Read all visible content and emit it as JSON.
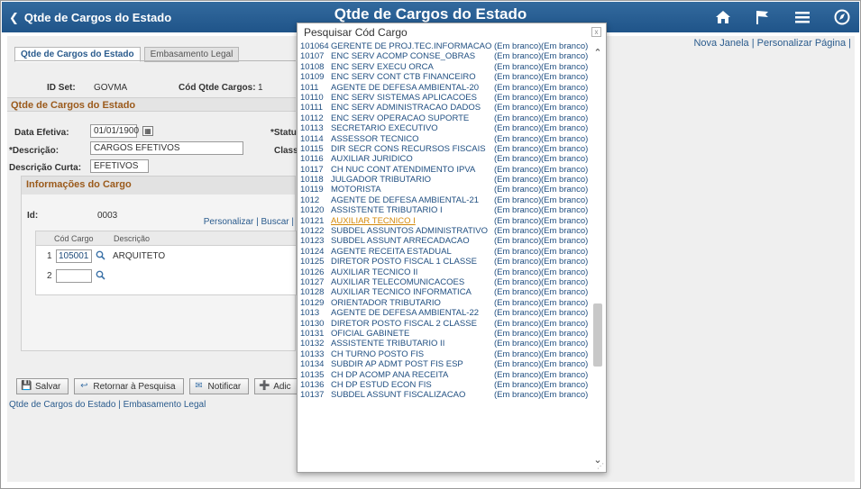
{
  "banner": {
    "back_label": "Qtde de Cargos do Estado",
    "title": "Qtde de Cargos do Estado",
    "icons": [
      "home-icon",
      "flag-icon",
      "menu-icon",
      "navbar-icon"
    ]
  },
  "right_links": {
    "new_window": "Nova Janela",
    "sep": "|",
    "personalize": "Personalizar Página",
    "sep2": "|"
  },
  "tabs": {
    "tab1": "Qtde de Cargos do Estado",
    "tab2": "Embasamento Legal"
  },
  "header": {
    "set_id_label": "ID Set:",
    "set_id_value": "GOVMA",
    "cod_label": "Cód Qtde Cargos:",
    "cod_value": "1"
  },
  "section": {
    "title": "Qtde de Cargos do Estado"
  },
  "form": {
    "data_label": "Data Efetiva:",
    "data_value": "01/01/1900",
    "status_label": "*Statu",
    "descr_label": "*Descrição:",
    "descr_value": "CARGOS EFETIVOS",
    "class_label": "Class",
    "descr_curta_label": "Descrição Curta:",
    "descr_curta_value": "EFETIVOS"
  },
  "cargo": {
    "title": "Informações do Cargo",
    "id_label": "Id:",
    "id_value": "0003",
    "links": "Personalizar | Buscar |",
    "col1": "Cód Cargo",
    "col2": "Descrição",
    "rows": [
      {
        "num": "1",
        "code": "105001",
        "desc": "ARQUITETO"
      },
      {
        "num": "2",
        "code": "",
        "desc": ""
      }
    ]
  },
  "toolbar": {
    "save": "Salvar",
    "return": "Retornar à Pesquisa",
    "notify": "Notificar",
    "add": "Adic"
  },
  "footer_links": "Qtde de Cargos do Estado | Embasamento Legal",
  "modal": {
    "title": "Pesquisar Cód Cargo",
    "close": "x",
    "rows": [
      {
        "code": "101064",
        "name": "GERENTE DE PROJ.TEC.INFORMACAO",
        "b1": "(Em branco)",
        "b2": "(Em branco)"
      },
      {
        "code": "10107",
        "name": "ENC SERV ACOMP CONSE_OBRAS",
        "b1": "(Em branco)",
        "b2": "(Em branco)"
      },
      {
        "code": "10108",
        "name": "ENC SERV EXECU ORCA",
        "b1": "(Em branco)",
        "b2": "(Em branco)"
      },
      {
        "code": "10109",
        "name": "ENC SERV CONT CTB FINANCEIRO",
        "b1": "(Em branco)",
        "b2": "(Em branco)"
      },
      {
        "code": "1011",
        "name": "AGENTE DE DEFESA AMBIENTAL-20",
        "b1": "(Em branco)",
        "b2": "(Em branco)"
      },
      {
        "code": "10110",
        "name": "ENC SERV SISTEMAS APLICACOES",
        "b1": "(Em branco)",
        "b2": "(Em branco)"
      },
      {
        "code": "10111",
        "name": "ENC SERV ADMINISTRACAO DADOS",
        "b1": "(Em branco)",
        "b2": "(Em branco)"
      },
      {
        "code": "10112",
        "name": "ENC SERV OPERACAO SUPORTE",
        "b1": "(Em branco)",
        "b2": "(Em branco)"
      },
      {
        "code": "10113",
        "name": "SECRETARIO EXECUTIVO",
        "b1": "(Em branco)",
        "b2": "(Em branco)"
      },
      {
        "code": "10114",
        "name": "ASSESSOR TECNICO",
        "b1": "(Em branco)",
        "b2": "(Em branco)"
      },
      {
        "code": "10115",
        "name": "DIR SECR CONS RECURSOS FISCAIS",
        "b1": "(Em branco)",
        "b2": "(Em branco)"
      },
      {
        "code": "10116",
        "name": "AUXILIAR JURIDICO",
        "b1": "(Em branco)",
        "b2": "(Em branco)"
      },
      {
        "code": "10117",
        "name": "CH NUC CONT ATENDIMENTO IPVA",
        "b1": "(Em branco)",
        "b2": "(Em branco)"
      },
      {
        "code": "10118",
        "name": "JULGADOR TRIBUTARIO",
        "b1": "(Em branco)",
        "b2": "(Em branco)"
      },
      {
        "code": "10119",
        "name": "MOTORISTA",
        "b1": "(Em branco)",
        "b2": "(Em branco)"
      },
      {
        "code": "1012",
        "name": "AGENTE DE DEFESA AMBIENTAL-21",
        "b1": "(Em branco)",
        "b2": "(Em branco)"
      },
      {
        "code": "10120",
        "name": "ASSISTENTE TRIBUTARIO I",
        "b1": "(Em branco)",
        "b2": "(Em branco)"
      },
      {
        "code": "10121",
        "name": "AUXILIAR TECNICO I",
        "b1": "(Em branco)",
        "b2": "(Em branco)"
      },
      {
        "code": "10122",
        "name": "SUBDEL ASSUNTOS ADMINISTRATIVO",
        "b1": "(Em branco)",
        "b2": "(Em branco)"
      },
      {
        "code": "10123",
        "name": "SUBDEL ASSUNT ARRECADACAO",
        "b1": "(Em branco)",
        "b2": "(Em branco)"
      },
      {
        "code": "10124",
        "name": "AGENTE RECEITA ESTADUAL",
        "b1": "(Em branco)",
        "b2": "(Em branco)"
      },
      {
        "code": "10125",
        "name": "DIRETOR POSTO FISCAL 1 CLASSE",
        "b1": "(Em branco)",
        "b2": "(Em branco)"
      },
      {
        "code": "10126",
        "name": "AUXILIAR TECNICO II",
        "b1": "(Em branco)",
        "b2": "(Em branco)"
      },
      {
        "code": "10127",
        "name": "AUXILIAR TELECOMUNICACOES",
        "b1": "(Em branco)",
        "b2": "(Em branco)"
      },
      {
        "code": "10128",
        "name": "AUXILIAR TECNICO INFORMATICA",
        "b1": "(Em branco)",
        "b2": "(Em branco)"
      },
      {
        "code": "10129",
        "name": "ORIENTADOR TRIBUTARIO",
        "b1": "(Em branco)",
        "b2": "(Em branco)"
      },
      {
        "code": "1013",
        "name": "AGENTE DE DEFESA AMBIENTAL-22",
        "b1": "(Em branco)",
        "b2": "(Em branco)"
      },
      {
        "code": "10130",
        "name": "DIRETOR POSTO FISCAL 2 CLASSE",
        "b1": "(Em branco)",
        "b2": "(Em branco)"
      },
      {
        "code": "10131",
        "name": "OFICIAL GABINETE",
        "b1": "(Em branco)",
        "b2": "(Em branco)"
      },
      {
        "code": "10132",
        "name": "ASSISTENTE TRIBUTARIO II",
        "b1": "(Em branco)",
        "b2": "(Em branco)"
      },
      {
        "code": "10133",
        "name": "CH TURNO POSTO FIS",
        "b1": "(Em branco)",
        "b2": "(Em branco)"
      },
      {
        "code": "10134",
        "name": "SUBDIR AP ADMT POST FIS ESP",
        "b1": "(Em branco)",
        "b2": "(Em branco)"
      },
      {
        "code": "10135",
        "name": "CH DP ACOMP ANA RECEITA",
        "b1": "(Em branco)",
        "b2": "(Em branco)"
      },
      {
        "code": "10136",
        "name": "CH DP ESTUD ECON FIS",
        "b1": "(Em branco)",
        "b2": "(Em branco)"
      },
      {
        "code": "10137",
        "name": "SUBDEL ASSUNT FISCALIZACAO",
        "b1": "(Em branco)",
        "b2": "(Em branco)"
      }
    ],
    "highlight_index": 17
  }
}
